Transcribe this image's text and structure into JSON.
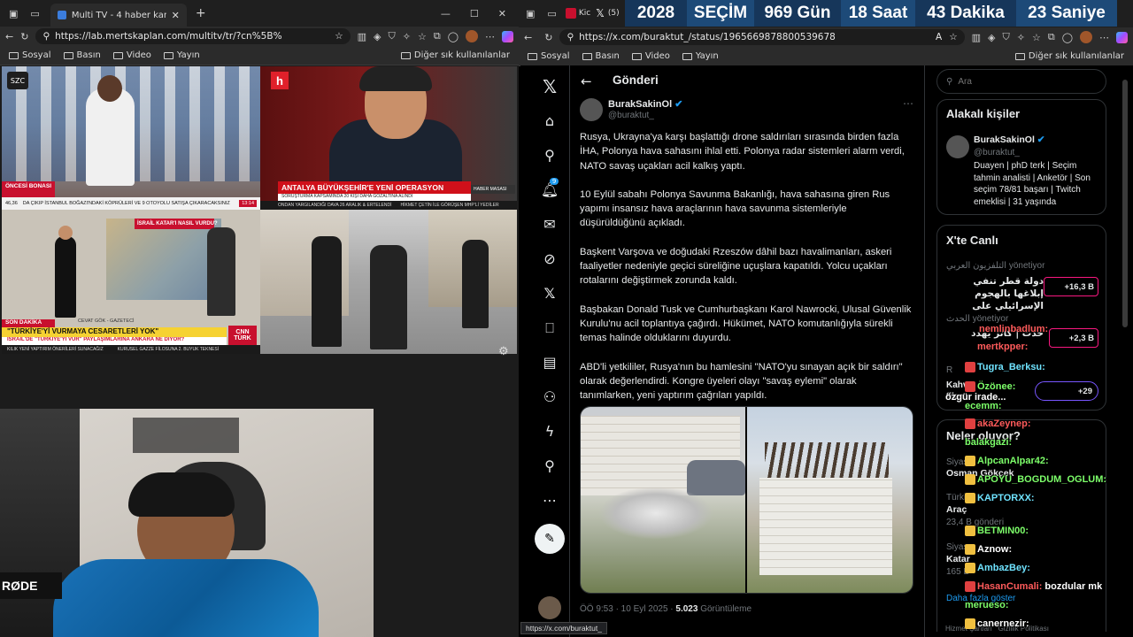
{
  "left_browser": {
    "tab_title": "Multi TV - 4 haber kanalını aynı a",
    "url": "https://lab.mertskaplan.com/multitv/tr/?cn%5B%",
    "bookmarks": [
      "Sosyal",
      "Basın",
      "Video",
      "Yayın"
    ],
    "other_bookmarks": "Diğer sık kullanılanlar"
  },
  "tv": {
    "szc": {
      "logo": "SZC",
      "tag": "ÖNCESİ BONASI",
      "ticker": "DA ÇIKIP İSTANBUL BOĞAZI'NDAKİ KÖPRÜLERİ VE 9 OTOYOLU SATIŞA ÇIKARACAKSINIZ",
      "temp": "46,36",
      "time": "13:14"
    },
    "halk": {
      "logo": "h",
      "headline": "ANTALYA BÜYÜKŞEHİR'E YENİ OPERASYON",
      "sub": "SORUŞTURMA KAPSAMINDA 20 KİŞİ DAHA GÖZALTINA ALINDI",
      "tag": "HABER MASASI",
      "ticker": "ONDAN YARGILANDIĞI DAVA 26 ARALIK & ERTELENDİ",
      "ticker2": "HİKMET ÇETİN İLE GÖRÜŞEN MHP'Lİ YEDİLER"
    },
    "cnn": {
      "map_label": "İSRAİL KATAR'I NASIL VURDU?",
      "reporter": "CEVAT GÖK - GAZETECİ",
      "tag": "SON DAKİKA",
      "headline": "\"TÜRKİYE'Yİ VURMAYA CESARETLERİ YOK\"",
      "sub": "İSRAİL'DE \"TÜRKİYE'Yİ VUR\" PAYLAŞIMLARINA ANKARA NE DİYOR?",
      "logo": "CNN TÜRK",
      "ticker": "KILIK YENİ YAPTIRIM ÖNERİLERİ SUNACAĞIZ",
      "ticker2": "KURUSEL GAZZE FİLOSUNA 2. BUYUK TEKNESİ"
    }
  },
  "timer": {
    "year": "2028",
    "label": "SEÇİM",
    "days": "969 Gün",
    "hours": "18 Saat",
    "minutes": "43 Dakika",
    "seconds": "23 Saniye"
  },
  "right_browser": {
    "tab_title": "Kic",
    "tab_count": "(5)",
    "url": "https://x.com/buraktut_/status/1965669878800539678",
    "bookmarks": [
      "Sosyal",
      "Basın",
      "Video",
      "Yayın"
    ],
    "other_bookmarks": "Diğer sık kullanılanlar",
    "status_url": "https://x.com/buraktut_"
  },
  "x": {
    "header": "Gönderi",
    "author_name": "BurakSakinOl",
    "author_handle": "@buraktut_",
    "paragraphs": [
      "Rusya, Ukrayna'ya karşı başlattığı drone saldırıları sırasında birden fazla İHA, Polonya hava sahasını ihlal etti. Polonya radar sistemleri alarm verdi, NATO savaş uçakları acil kalkış yaptı.",
      "10 Eylül sabahı Polonya Savunma Bakanlığı, hava sahasına giren Rus yapımı insansız hava araçlarının hava savunma sistemleriyle düşürüldüğünü açıkladı.",
      "Başkent Varşova ve doğudaki Rzeszów dâhil bazı havalimanları, askeri faaliyetler nedeniyle geçici süreliğine uçuşlara kapatıldı. Yolcu uçakları rotalarını değiştirmek zorunda kaldı.",
      "Başbakan Donald Tusk ve Cumhurbaşkanı Karol Nawrocki, Ulusal Güvenlik Kurulu'nu acil toplantıya çağırdı. Hükümet, NATO komutanlığıyla sürekli temas halinde olduklarını duyurdu.",
      "ABD'li yetkililer, Rusya'nın bu hamlesini \"NATO'yu sınayan açık bir saldırı\" olarak değerlendirdi. Kongre üyeleri olayı \"savaş eylemi\" olarak tanımlarken, yeni yaptırım çağrıları yapıldı."
    ],
    "time": "ÖÖ 9:53 · 10 Eyl 2025 · ",
    "views": "5.023",
    "views_label": "Görüntüleme",
    "notif_count": "9",
    "search_placeholder": "Ara",
    "related_title": "Alakalı kişiler",
    "related_name": "BurakSakinOl",
    "related_handle": "@buraktut_",
    "related_bio": "Duayen | phD terk | Seçim tahmin analisti | Anketör | Son seçim 78/81 başarı | Twitch emeklisi | 31 yaşında",
    "live_title": "X'te Canlı",
    "live1_host": "التلفزيون العربي",
    "live1_action": "yönetiyor",
    "live1_text": "دولة قطر تنفي إبلاغها بالهجوم الإسرائيلي على",
    "live1_count": "+16,3 B",
    "live2_host": "الحدث",
    "live2_action": "yönetiyor",
    "live2_text": "حدث | كاتز يهدد",
    "live2_count": "+2,3 B",
    "live3_host": "R",
    "live3_text": "Kahv filan",
    "live3_count": "+29",
    "trends_title": "Neler oluyor?",
    "trends": [
      {
        "meta": "Siyas",
        "name": "Osman Gökçek"
      },
      {
        "meta": "Türkiy",
        "name": "Araç",
        "posts": "23,4 B gönderi"
      },
      {
        "meta": "Siyas",
        "name": "Katar",
        "posts": "165 B"
      }
    ],
    "show_more": "Daha fazla göster",
    "footer": "Hizmet Şartları   Gizlilik Politikası"
  },
  "chat": [
    {
      "user": "Tugra_Berksu:",
      "msg": "",
      "color": "cyan"
    },
    {
      "user": "Özönee:",
      "msg": "özgür irade...",
      "color": "green"
    },
    {
      "user": "ecemm:",
      "msg": "",
      "color": "green"
    },
    {
      "user": "akaZeynep:",
      "msg": "",
      "color": "red"
    },
    {
      "user": "balakgazi:",
      "msg": "",
      "color": "green"
    },
    {
      "user": "AlpcanAlpar42:",
      "msg": "",
      "color": "green"
    },
    {
      "user": "APOYU_BOGDUM_OGLUM:",
      "msg": "",
      "color": "green"
    },
    {
      "user": "KAPTORXX:",
      "msg": "",
      "color": "cyan"
    },
    {
      "user": "BETMIN00:",
      "msg": "",
      "color": "green"
    },
    {
      "user": "Aznow:",
      "msg": "",
      "color": "white"
    },
    {
      "user": "AmbazBey:",
      "msg": "",
      "color": "cyan"
    },
    {
      "user": "HasanCumali:",
      "msg": "bozdular mk",
      "color": "red"
    },
    {
      "user": "merueso:",
      "msg": "",
      "color": "green"
    },
    {
      "user": "canernezir:",
      "msg": "",
      "color": "white"
    },
    {
      "user": "mertkpper:",
      "msg": "",
      "color": "red"
    },
    {
      "user": "nemlinbadlum:",
      "msg": "",
      "color": "red"
    }
  ],
  "webcam": {
    "mic_brand": "RØDE"
  }
}
